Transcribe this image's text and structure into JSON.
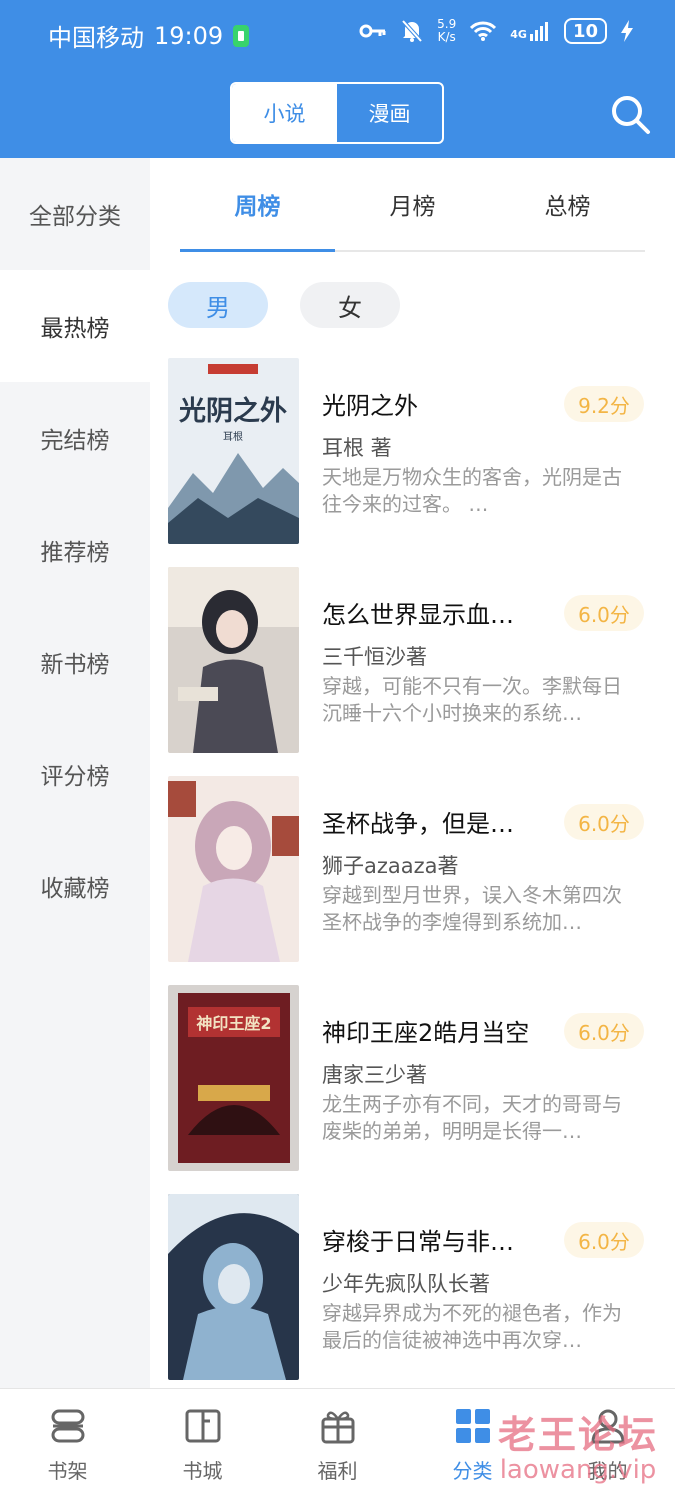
{
  "status_bar": {
    "carrier": "中国移动",
    "time": "19:09",
    "speed_value": "5.9",
    "speed_unit": "K/s",
    "network": "4G",
    "battery": "10"
  },
  "header": {
    "tabs": [
      {
        "label": "小说",
        "active": true
      },
      {
        "label": "漫画",
        "active": false
      }
    ],
    "search_icon": "search-icon"
  },
  "sidebar": {
    "items": [
      {
        "label": "全部分类"
      },
      {
        "label": "最热榜",
        "selected": true
      },
      {
        "label": "完结榜"
      },
      {
        "label": "推荐榜"
      },
      {
        "label": "新书榜"
      },
      {
        "label": "评分榜"
      },
      {
        "label": "收藏榜"
      }
    ]
  },
  "rank_tabs": [
    {
      "label": "周榜",
      "active": true
    },
    {
      "label": "月榜"
    },
    {
      "label": "总榜"
    }
  ],
  "gender_filter": [
    {
      "label": "男",
      "active": true
    },
    {
      "label": "女"
    }
  ],
  "books": [
    {
      "title": "光阴之外",
      "score": "9.2分",
      "author": "耳根 著",
      "desc": "天地是万物众生的客舍，光阴是古往今来的过客。 …",
      "cover_title": "光阴之外",
      "cover_colors": [
        "#e9eef3",
        "#7f98ad",
        "#34495d"
      ]
    },
    {
      "title": "怎么世界显示血…",
      "score": "6.0分",
      "author": "三千恒沙著",
      "desc": "穿越，可能不只有一次。李默每日沉睡十六个小时换来的系统…",
      "cover_title": "",
      "cover_colors": [
        "#d8d2cc",
        "#4b4a55",
        "#2a2b33"
      ]
    },
    {
      "title": "圣杯战争，但是…",
      "score": "6.0分",
      "author": "狮子azaaza著",
      "desc": "穿越到型月世界，误入冬木第四次圣杯战争的李煌得到系统加…",
      "cover_title": "",
      "cover_colors": [
        "#f3e9e4",
        "#c9a7b8",
        "#a64b3c"
      ]
    },
    {
      "title": "神印王座2皓月当空",
      "score": "6.0分",
      "author": "唐家三少著",
      "desc": "龙生两子亦有不同，天才的哥哥与废柴的弟弟，明明是长得一…",
      "cover_title": "神印王座2",
      "cover_colors": [
        "#6e1d22",
        "#b23232",
        "#2f1012"
      ]
    },
    {
      "title": "穿梭于日常与非…",
      "score": "6.0分",
      "author": "少年先疯队队长著",
      "desc": "穿越异界成为不死的褪色者，作为最后的信徒被神选中再次穿…",
      "cover_title": "",
      "cover_colors": [
        "#27354a",
        "#8fb2cf",
        "#dfe8f0"
      ]
    }
  ],
  "bottom_nav": [
    {
      "label": "书架",
      "icon": "bookshelf-icon"
    },
    {
      "label": "书城",
      "icon": "book-open-icon"
    },
    {
      "label": "福利",
      "icon": "gift-icon"
    },
    {
      "label": "分类",
      "icon": "grid-icon",
      "active": true
    },
    {
      "label": "我的",
      "icon": "user-icon"
    }
  ],
  "watermark": {
    "line1": "老王论坛",
    "line2": "laowang.vip"
  },
  "colors": {
    "accent": "#3f8ee6",
    "score": "#f3b545"
  }
}
